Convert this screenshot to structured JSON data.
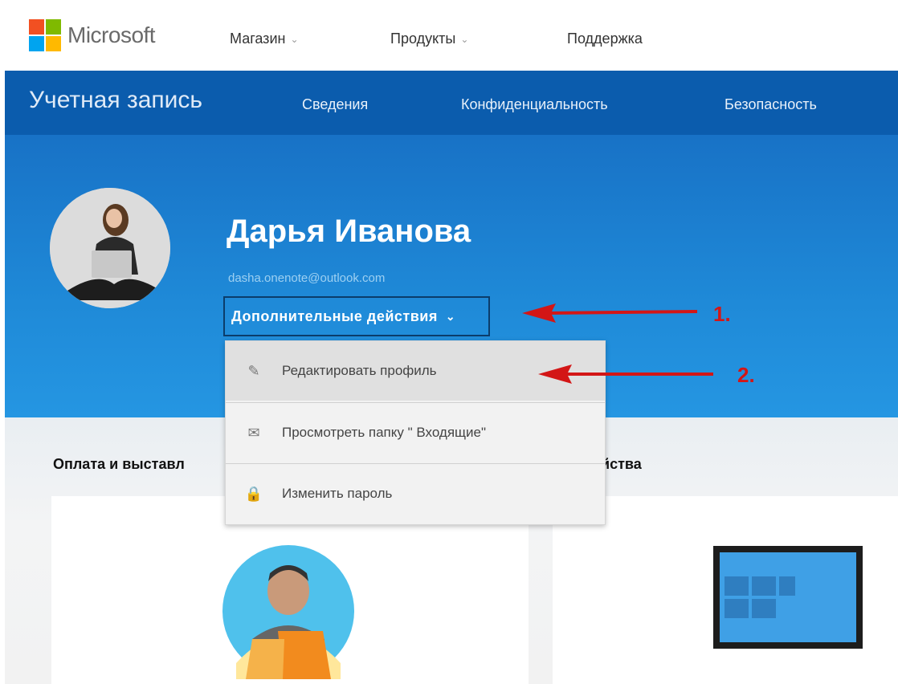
{
  "header": {
    "brand": "Microsoft",
    "nav": [
      {
        "label": "Магазин",
        "has_dropdown": true
      },
      {
        "label": "Продукты",
        "has_dropdown": true
      },
      {
        "label": "Поддержка",
        "has_dropdown": false
      }
    ],
    "logo_colors": [
      "#f25022",
      "#7fba00",
      "#00a4ef",
      "#ffb900"
    ]
  },
  "account_bar": {
    "title": "Учетная запись",
    "tabs": [
      "Сведения",
      "Конфиденциальность",
      "Безопасность"
    ],
    "color": "#0b5cad"
  },
  "profile": {
    "name": "Дарья Иванова",
    "email": "dasha.onenote@outlook.com",
    "more_actions": "Дополнительные действия",
    "more_actions_chevron": "⌄"
  },
  "dropdown": {
    "items": [
      {
        "label": "Редактировать профиль",
        "icon": "pencil-icon",
        "glyph": "✎"
      },
      {
        "label": "Просмотреть папку \" Входящие\"",
        "icon": "envelope-icon",
        "glyph": "✉"
      },
      {
        "label": "Изменить пароль",
        "icon": "lock-icon",
        "glyph": "🔒"
      }
    ]
  },
  "sections": {
    "left_title": "Оплата и выставл",
    "right_title": "йства"
  },
  "annotations": {
    "first": "1.",
    "second": "2.",
    "color": "#d31616"
  }
}
